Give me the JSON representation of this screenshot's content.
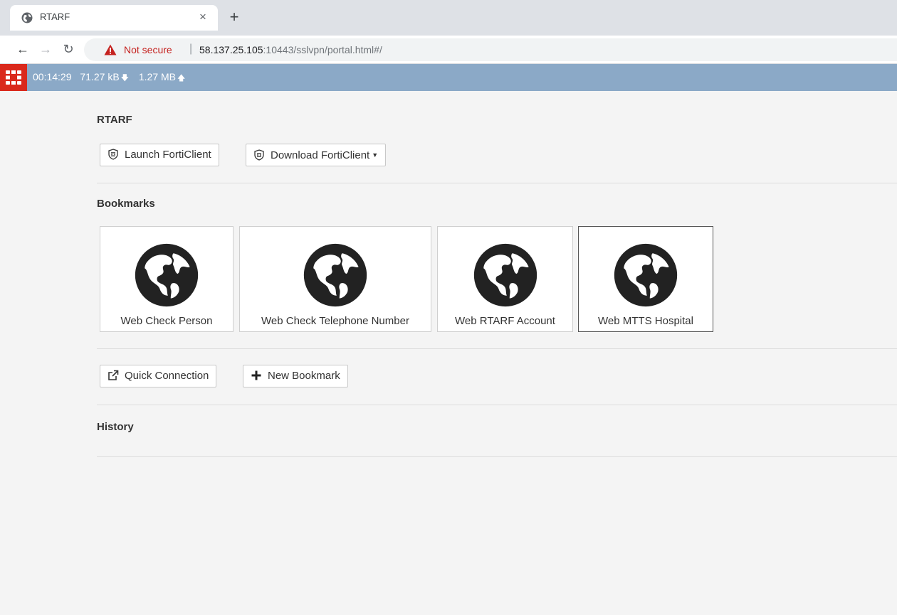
{
  "browser": {
    "tab_title": "RTARF",
    "tab_close": "×",
    "new_tab": "+",
    "security_label": "Not secure",
    "url_host": "58.137.25.105",
    "url_rest": ":10443/sslvpn/portal.html#/"
  },
  "status_bar": {
    "duration": "00:14:29",
    "bytes_in": "71.27 kB",
    "bytes_out": "1.27 MB",
    "bar_color": "#8ba9c7",
    "logo_color": "#da291c"
  },
  "portal": {
    "title": "RTARF",
    "launch_button": "Launch FortiClient",
    "download_button": "Download FortiClient",
    "bookmarks_heading": "Bookmarks",
    "bookmarks": [
      {
        "label": "Web Check Person",
        "icon": "globe-icon"
      },
      {
        "label": "Web Check Telephone Number",
        "icon": "globe-icon"
      },
      {
        "label": "Web RTARF Account",
        "icon": "globe-icon"
      },
      {
        "label": "Web MTTS Hospital",
        "icon": "globe-icon"
      }
    ],
    "quick_connection_button": "Quick Connection",
    "new_bookmark_button": "New Bookmark",
    "history_heading": "History"
  }
}
